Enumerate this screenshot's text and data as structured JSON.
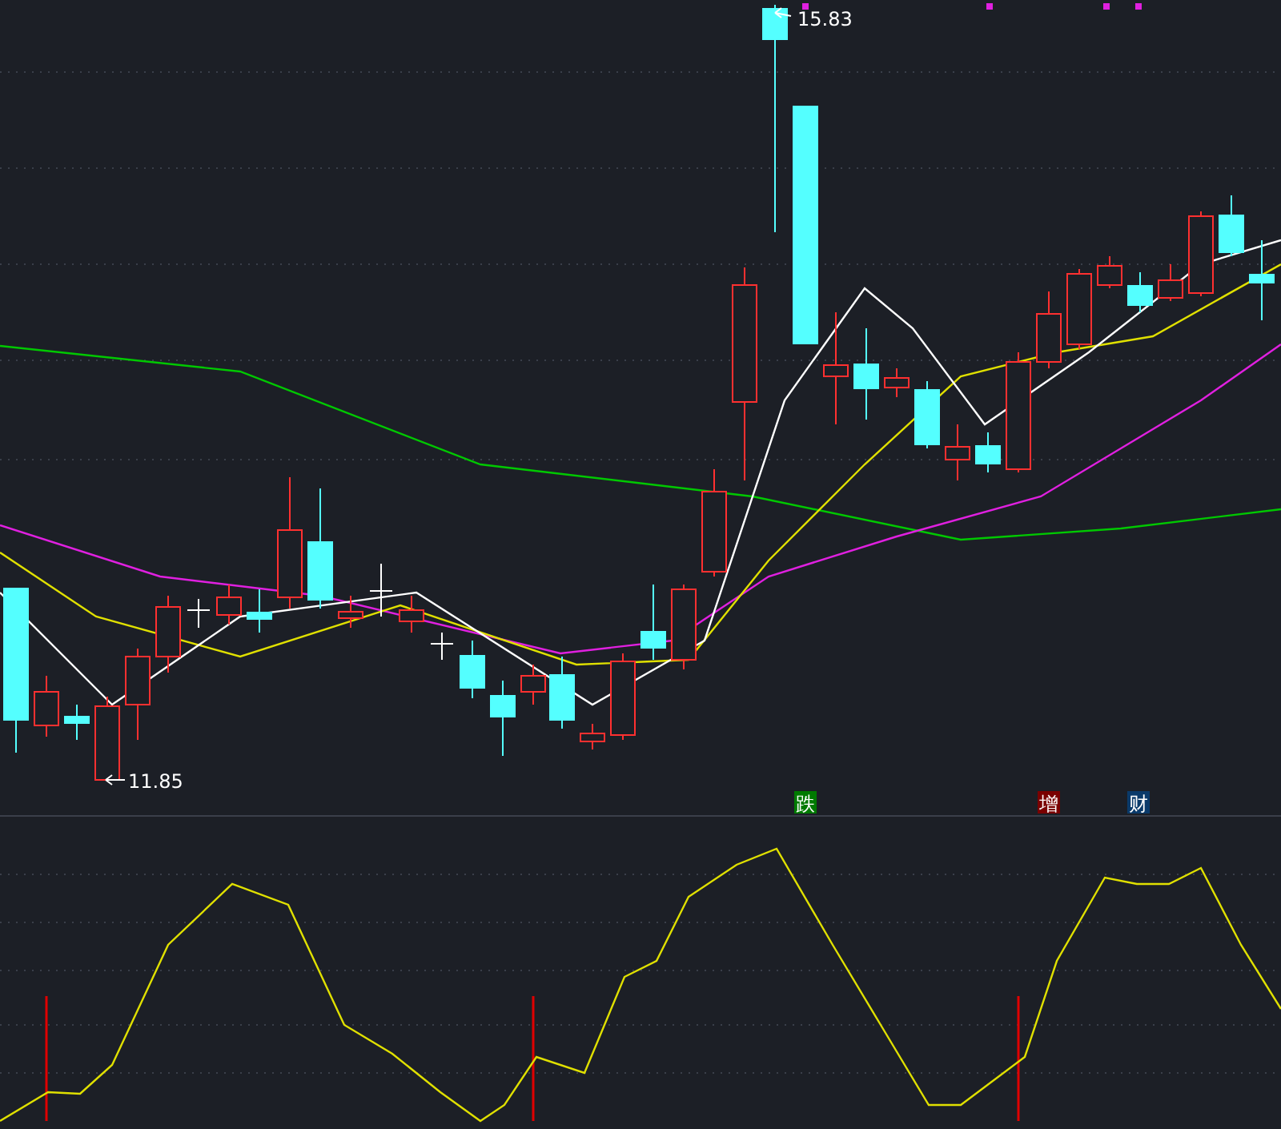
{
  "price_pane": {
    "high_label": "15.83",
    "low_label": "11.85",
    "signal_tags": [
      {
        "text": "跌",
        "color": "#007a00"
      },
      {
        "text": "增",
        "color": "#7a0000"
      },
      {
        "text": "财",
        "color": "#0a3a6a"
      }
    ]
  }
}
